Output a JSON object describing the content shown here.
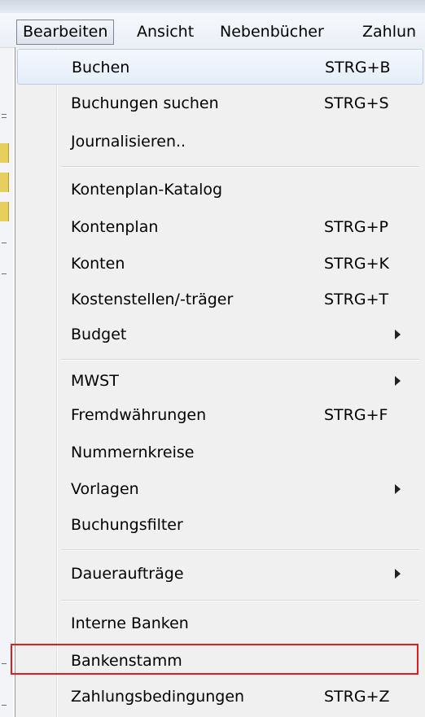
{
  "menubar": {
    "items": [
      {
        "label": "Bearbeiten",
        "open": true
      },
      {
        "label": "Ansicht"
      },
      {
        "label": "Nebenbücher"
      },
      {
        "label": "Zahlun"
      }
    ]
  },
  "menu": {
    "items": [
      {
        "label": "Buchen",
        "shortcut": "STRG+B"
      },
      {
        "label": "Buchungen suchen",
        "shortcut": "STRG+S"
      },
      {
        "label": "Journalisieren..",
        "shortcut": ""
      },
      {
        "label": "Kontenplan-Katalog",
        "shortcut": ""
      },
      {
        "label": "Kontenplan",
        "shortcut": "STRG+P"
      },
      {
        "label": "Konten",
        "shortcut": "STRG+K"
      },
      {
        "label": "Kostenstellen/-träger",
        "shortcut": "STRG+T"
      },
      {
        "label": "Budget",
        "shortcut": ""
      },
      {
        "label": "MWST",
        "shortcut": ""
      },
      {
        "label": "Fremdwährungen",
        "shortcut": "STRG+F"
      },
      {
        "label": "Nummernkreise",
        "shortcut": ""
      },
      {
        "label": "Vorlagen",
        "shortcut": ""
      },
      {
        "label": "Buchungsfilter",
        "shortcut": ""
      },
      {
        "label": "Daueraufträge",
        "shortcut": ""
      },
      {
        "label": "Interne Banken",
        "shortcut": ""
      },
      {
        "label": "Bankenstamm",
        "shortcut": ""
      },
      {
        "label": "Zahlungsbedingungen",
        "shortcut": "STRG+Z"
      }
    ]
  },
  "colors": {
    "highlight_border": "#e11b22",
    "hover_background": "#e4edf8",
    "menu_background": "#f0f0f0"
  }
}
